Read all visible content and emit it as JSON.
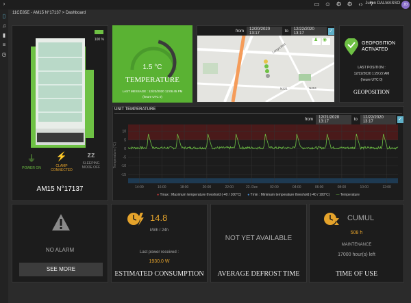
{
  "topbar": {
    "user_name": "Julien DALMASSO",
    "avatar_initials": "JD",
    "icons": [
      "monitor-icon",
      "users-icon",
      "gear-icon",
      "network-icon",
      "code-icon",
      "help-icon"
    ]
  },
  "breadcrumb": "11CE85E - AM15 N°17137 > Dashboard",
  "device": {
    "battery_label": "100 %",
    "name": "AM15 N°17137",
    "statuses": [
      {
        "label": "POWER ON",
        "color": "#6ec144"
      },
      {
        "label": "CLAMP CONNECTED",
        "color": "#e5a32b"
      },
      {
        "label": "SLEEPING MODE OFF",
        "color": "#9a9a9a"
      }
    ]
  },
  "temperature_tile": {
    "value": "1.5 °C",
    "title": "TEMPERATURE",
    "last_message": "LAST MESSAGE : 12/22/2020 12:06:45 PM",
    "timezone": "(heure UTC 0)",
    "gauge_fraction": 0.55
  },
  "map": {
    "from_label": "from",
    "from_value": "12/20/2020 13:17",
    "to_label": "to",
    "to_value": "12/22/2020 13:17",
    "road_labels": [
      "Langenfeld",
      "N364",
      "N321"
    ]
  },
  "geoposition": {
    "status": "GEOPOSITION ACTIVATED",
    "last_position_label": "LAST POSITION :",
    "last_position_value": "12/22/2020 1:29:22 AM",
    "timezone": "(heure UTC 0)",
    "title": "GEOPOSITION"
  },
  "unit_temperature": {
    "title": "UNIT TEMPERATURE",
    "from_label": "from",
    "from_value": "12/21/2020 13:17",
    "to_label": "to",
    "to_value": "12/22/2020 13:17",
    "y_axis_label": "Temperature (°C)",
    "legend": [
      {
        "label": "Tmax : Maximum temperature threshold (-40 / 100°C)",
        "color": "#d13a3a"
      },
      {
        "label": "Tmin : Minimum temperature threshold (-40 / 100°C)",
        "color": "#4a90d9"
      },
      {
        "label": "Temperature",
        "color": "#6ec144"
      }
    ]
  },
  "chart_data": {
    "type": "line",
    "x": [
      "14:00",
      "16:00",
      "18:00",
      "20:00",
      "22:00",
      "22. Dec",
      "02:00",
      "04:00",
      "06:00",
      "08:00",
      "10:00",
      "12:00"
    ],
    "ylim": [
      -20,
      14
    ],
    "y_ticks": [
      10,
      5,
      0,
      -5,
      -10,
      -15
    ],
    "series": [
      {
        "name": "Temperature",
        "color": "#6ec144",
        "baseline": 0.5,
        "peaks_at": [
          14.8,
          17.4,
          20.1,
          22.6,
          25.2,
          28.0,
          30.7,
          33.3,
          35.7
        ]
      }
    ],
    "tmax_band": [
      5,
      14
    ],
    "tmin_band": [
      -20,
      -17
    ]
  },
  "alarm": {
    "status": "NO ALARM",
    "button": "SEE MORE"
  },
  "consumption": {
    "value": "14.8",
    "unit": "kWh / 24h",
    "last_received_label": "Last power received :",
    "last_received_value": "1930.0 W",
    "title": "ESTIMATED CONSUMPTION"
  },
  "defrost": {
    "status": "NOT YET AVAILABLE",
    "title": "AVERAGE DEFROST TIME"
  },
  "time_of_use": {
    "label": "CUMUL",
    "hours": "508 h",
    "maintenance_label": "MAINTENANCE",
    "remaining": "17000 hour(s) left",
    "title": "TIME OF USE"
  }
}
